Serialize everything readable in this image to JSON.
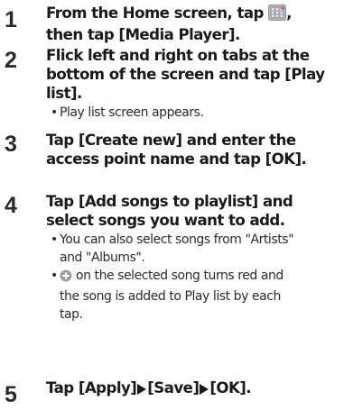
{
  "steps": [
    {
      "number": "1",
      "title_line1_before_icon": "From the Home screen, tap",
      "title_line1_after_icon": ",",
      "title_line2": "then tap [Media Player].",
      "icon": "apps-grid-icon"
    },
    {
      "number": "2",
      "title_line1": "Flick left and right on tabs at the",
      "title_line2": "bottom of the screen and tap [Play",
      "title_line3": "list].",
      "bullets": [
        {
          "line1": "Play list screen appears."
        }
      ]
    },
    {
      "number": "3",
      "title_line1": "Tap [Create new] and enter the",
      "title_line2": "access point name and tap [OK]."
    },
    {
      "number": "4",
      "title_line1": "Tap [Add songs to playlist] and",
      "title_line2": "select songs you want to add.",
      "bullets": [
        {
          "line1": "You can also select songs from \"Artists\"",
          "line2": "and \"Albums\"."
        },
        {
          "icon": "add-circle-icon",
          "line1": " on the selected song turns red and",
          "line2": "the song is added to Play list by each",
          "line3": "tap."
        }
      ]
    },
    {
      "number": "5",
      "title_part1": "Tap [Apply]",
      "title_part2": "[Save]",
      "title_part3": "[OK].",
      "arrow_icon": "right-triangle-icon"
    }
  ],
  "colors": {
    "text": "#1a1a1a",
    "icon_bg": "#9aa0a6",
    "icon_red": "#d9534f",
    "add_icon": "#9e9e9e"
  }
}
